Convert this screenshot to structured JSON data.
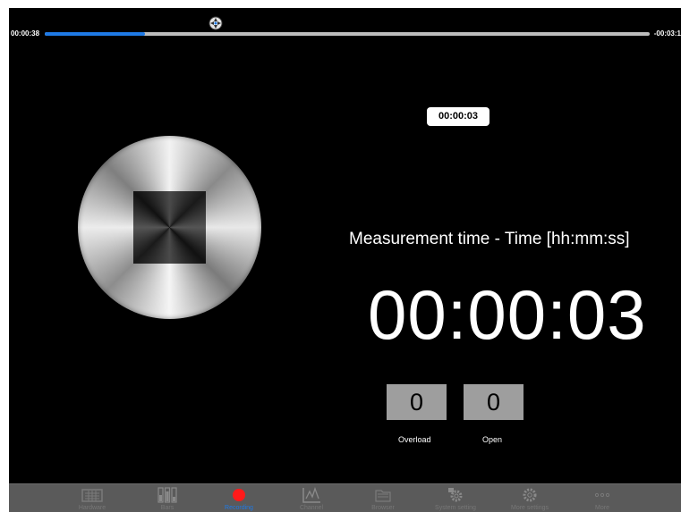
{
  "scrubber": {
    "elapsed": "00:00:38",
    "remaining": "-00:03:1",
    "progress": 0.165
  },
  "timer_badge": "00:00:03",
  "measurement": {
    "label": "Measurement time - Time [hh:mm:ss]",
    "value": "00:00:03"
  },
  "counters": [
    {
      "label": "Overload",
      "value": "0"
    },
    {
      "label": "Open",
      "value": "0"
    }
  ],
  "tabs": [
    {
      "label": "Hardware",
      "icon": "keyboard-icon"
    },
    {
      "label": "Bars",
      "icon": "sliders-icon"
    },
    {
      "label": "Recording",
      "icon": "record-icon"
    },
    {
      "label": "Channel",
      "icon": "chart-icon"
    },
    {
      "label": "Browser",
      "icon": "folder-icon"
    },
    {
      "label": "System setting",
      "icon": "gear-icon"
    },
    {
      "label": "More settings",
      "icon": "gear-icon"
    },
    {
      "label": "More",
      "icon": "more-icon"
    }
  ],
  "colors": {
    "accent": "#1f7ae6",
    "record": "#ff1a1a",
    "counter_bg": "#9e9e9e",
    "tabbar_bg": "#5a5a5a"
  }
}
